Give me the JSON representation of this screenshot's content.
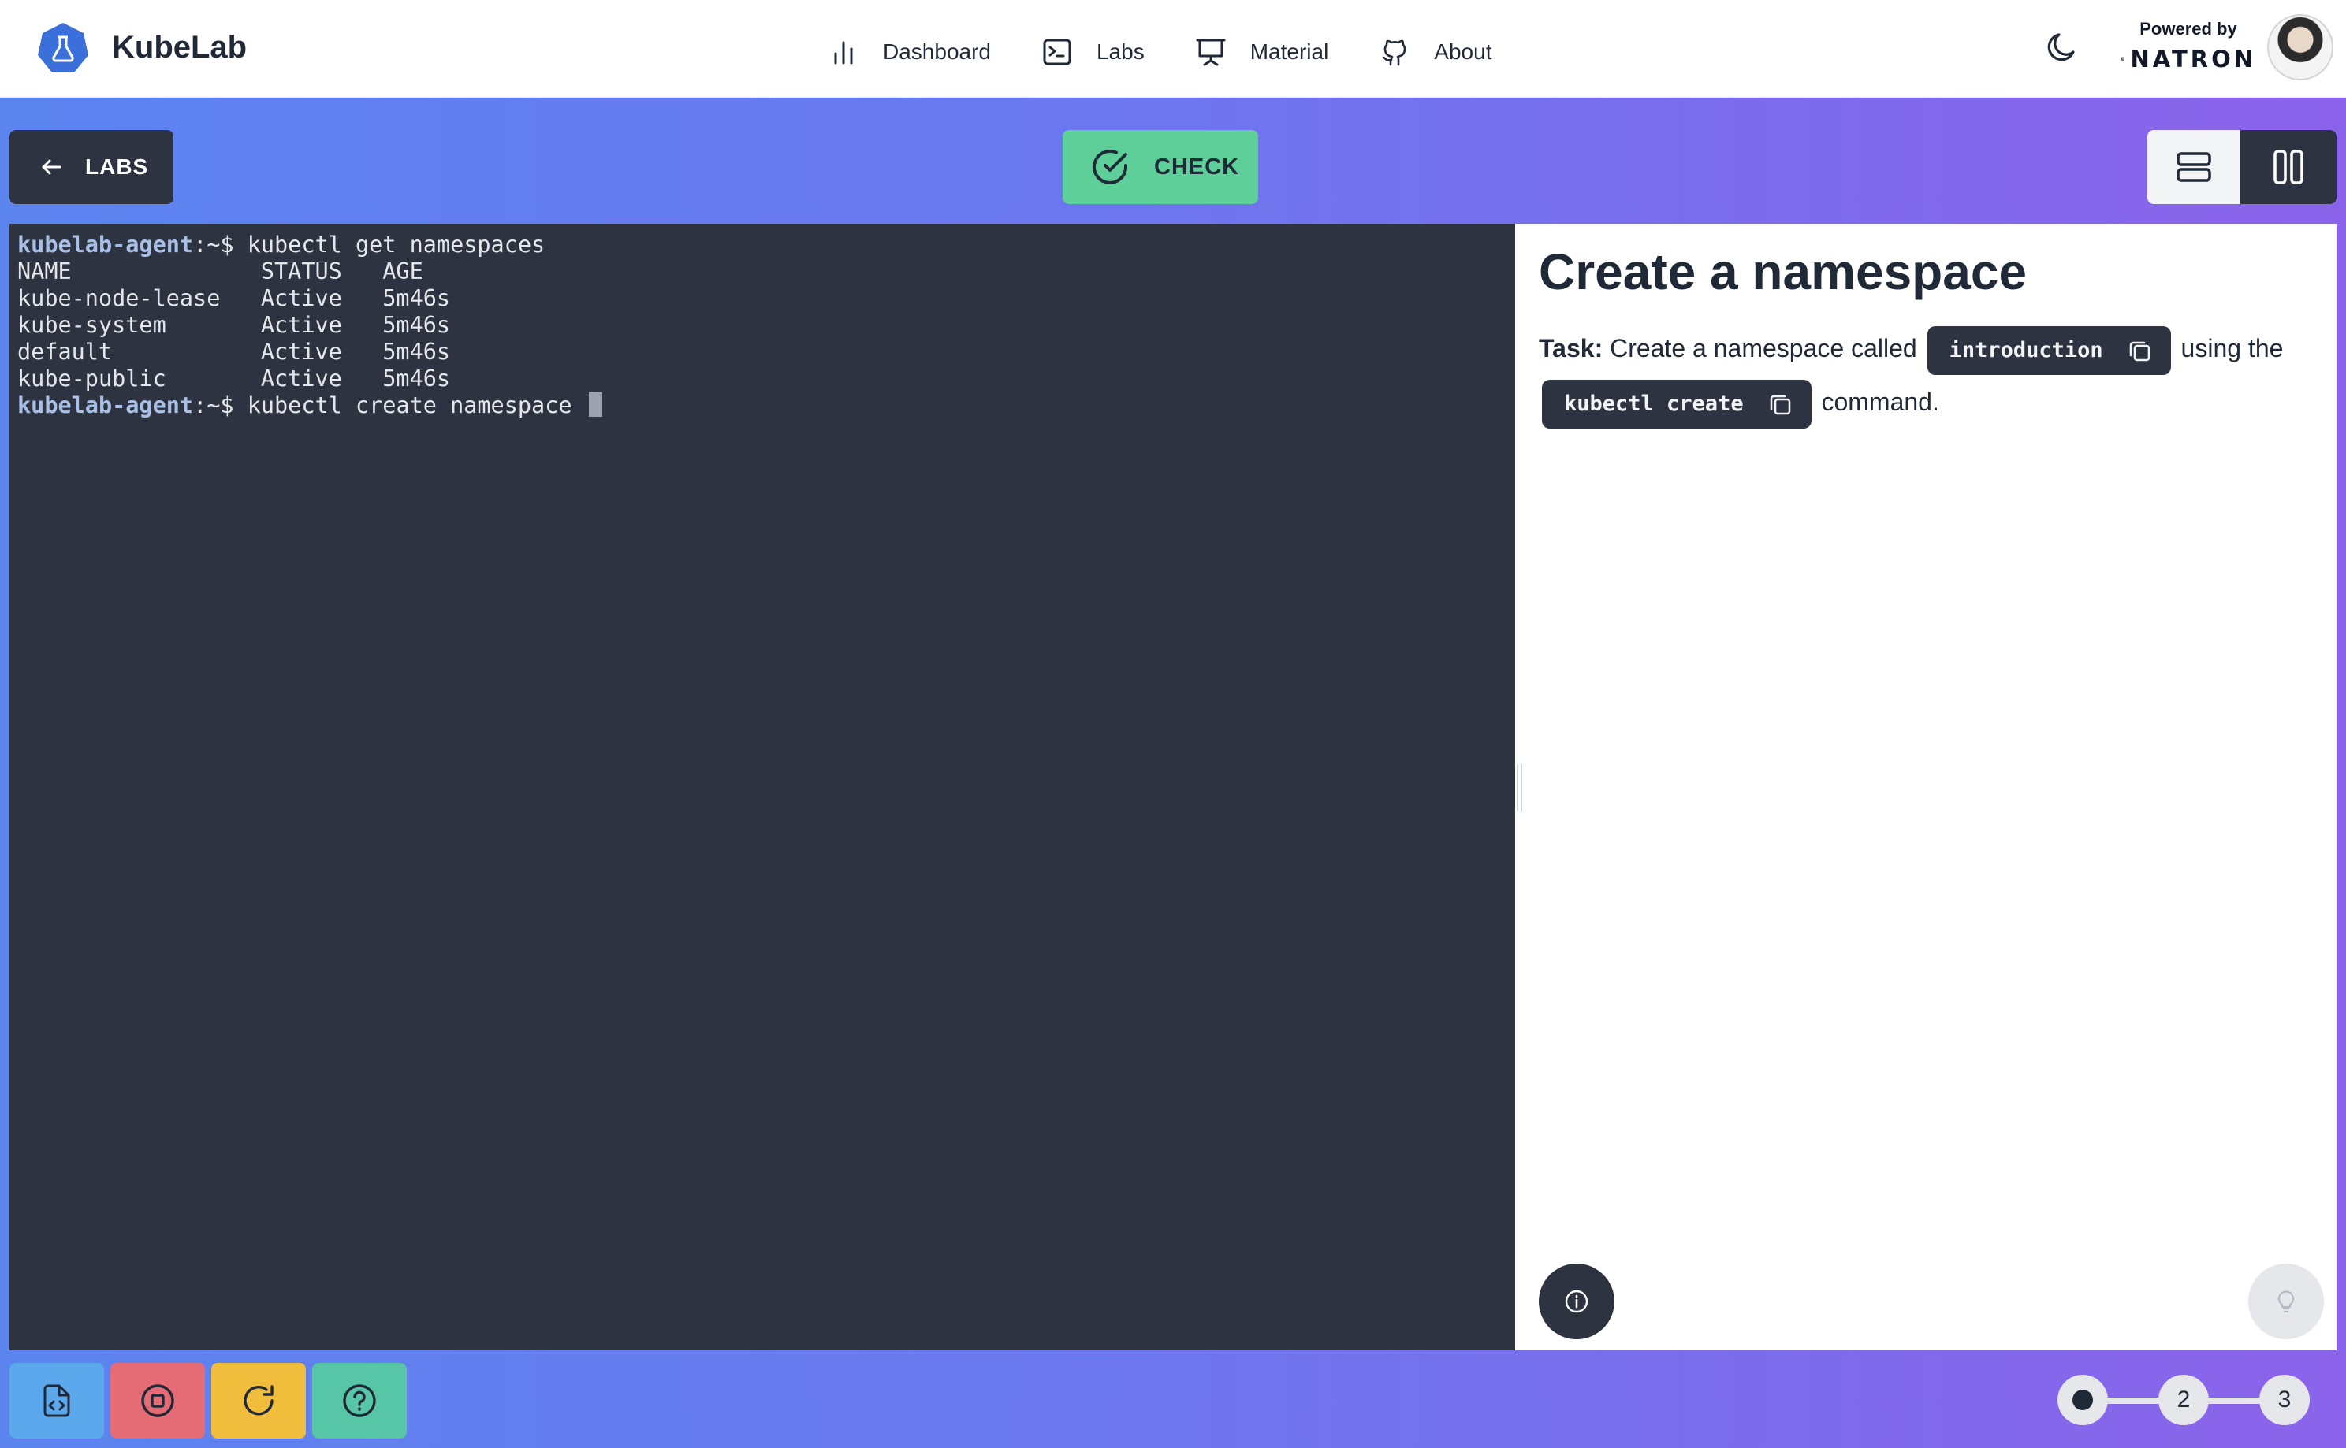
{
  "header": {
    "brand": "KubeLab",
    "nav": [
      {
        "label": "Dashboard",
        "icon": "bar-chart-icon"
      },
      {
        "label": "Labs",
        "icon": "terminal-icon"
      },
      {
        "label": "Material",
        "icon": "presentation-icon"
      },
      {
        "label": "About",
        "icon": "github-icon"
      }
    ],
    "powered_by": "Powered by",
    "partner": "NATRON"
  },
  "toolbar": {
    "labs_label": "LABS",
    "check_label": "CHECK"
  },
  "terminal": {
    "lines": [
      {
        "user": "kubelab-agent",
        "suffix": ":~$ ",
        "cmd": "kubectl get namespaces"
      },
      {
        "text": "NAME              STATUS   AGE"
      },
      {
        "text": "kube-node-lease   Active   5m46s"
      },
      {
        "text": "kube-system       Active   5m46s"
      },
      {
        "text": "default           Active   5m46s"
      },
      {
        "text": "kube-public       Active   5m46s"
      },
      {
        "user": "kubelab-agent",
        "suffix": ":~$ ",
        "cmd": "kubectl create namespace "
      }
    ]
  },
  "instructions": {
    "title": "Create a namespace",
    "task_label": "Task:",
    "text_1": "Create a namespace called",
    "code_1": "introduction",
    "text_2": "using the",
    "code_2": "kubectl create",
    "text_3": "command."
  },
  "progress": {
    "steps": [
      "1",
      "2",
      "3"
    ],
    "current": 1
  },
  "colors": {
    "terminal_bg": "#2d3340",
    "check_green": "#5ecf98",
    "gradient_start": "#5b84ef",
    "gradient_end": "#8b63ea"
  }
}
